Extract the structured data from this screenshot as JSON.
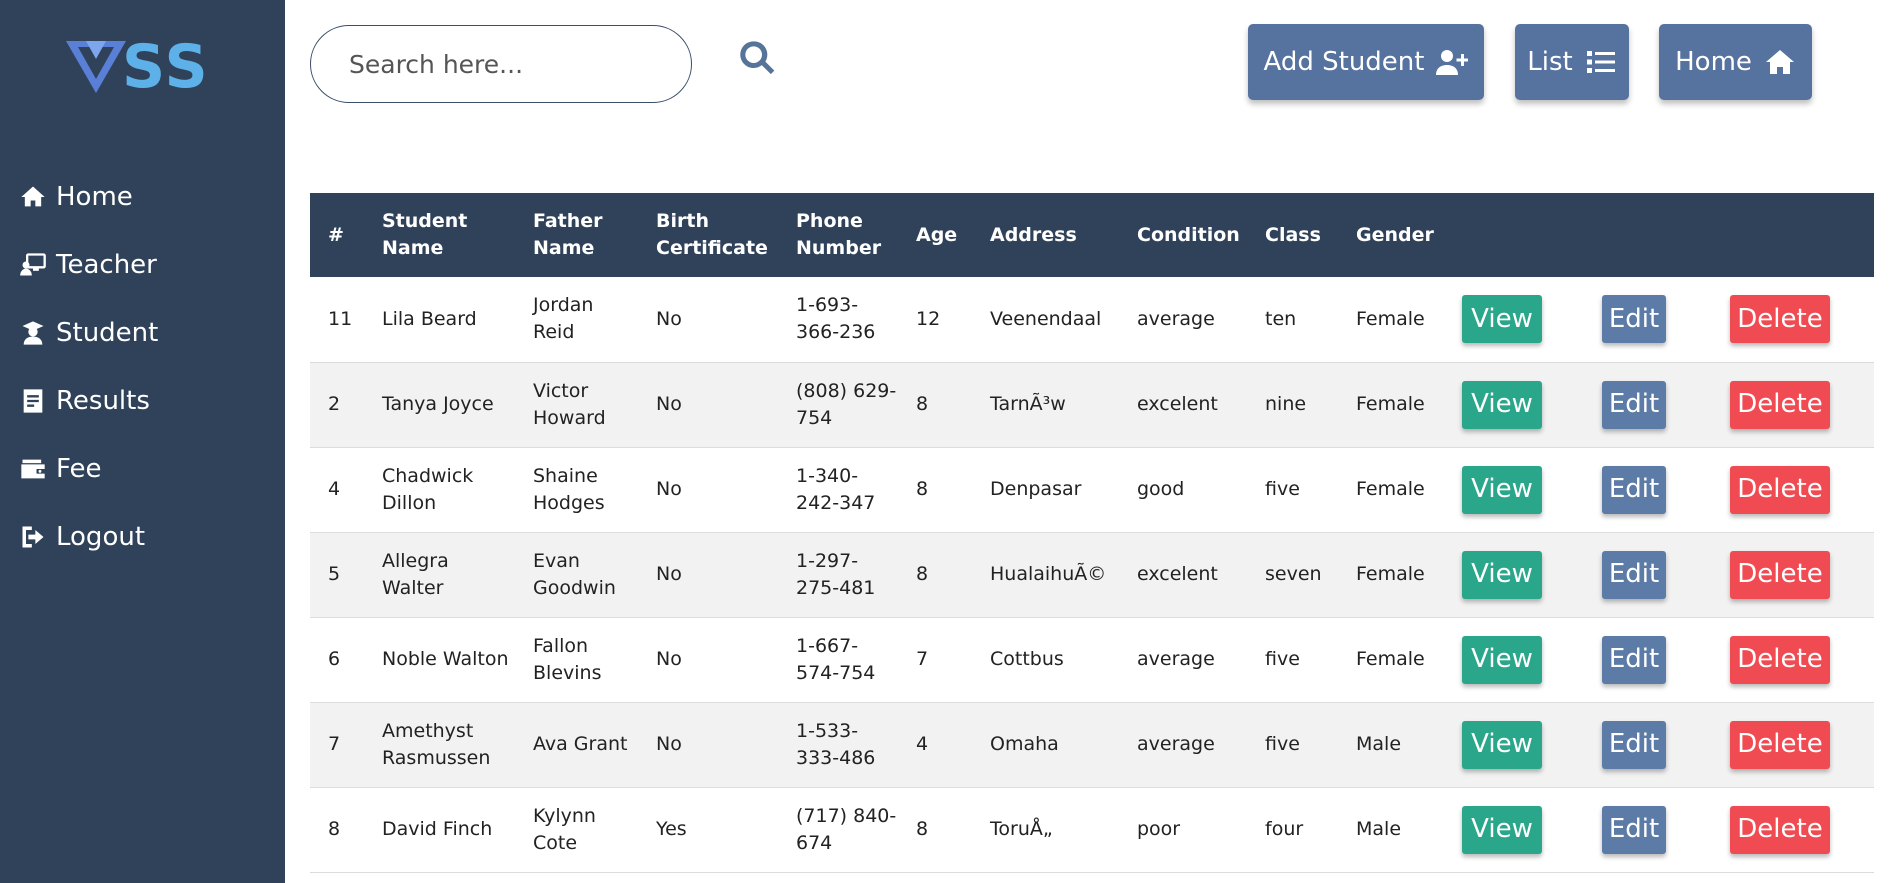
{
  "sidebar": {
    "logo_text": "SS",
    "logo_mark": "V",
    "items": [
      {
        "label": "Home",
        "icon": "home-icon"
      },
      {
        "label": "Teacher",
        "icon": "teacher-icon"
      },
      {
        "label": "Student",
        "icon": "student-icon"
      },
      {
        "label": "Results",
        "icon": "results-icon"
      },
      {
        "label": "Fee",
        "icon": "wallet-icon"
      },
      {
        "label": "Logout",
        "icon": "logout-icon"
      }
    ]
  },
  "search": {
    "placeholder": "Search here...",
    "value": ""
  },
  "toolbar": {
    "add_student": "Add Student",
    "list": "List",
    "home": "Home"
  },
  "table": {
    "headers": [
      "#",
      "Student Name",
      "Father Name",
      "Birth Certificate",
      "Phone Number",
      "Age",
      "Address",
      "Condition",
      "Class",
      "Gender"
    ],
    "rows": [
      {
        "id": "11",
        "student": "Lila Beard",
        "father": "Jordan Reid",
        "birth": "No",
        "phone": "1-693-366-236",
        "age": "12",
        "address": "Veenendaal",
        "condition": "average",
        "class": "ten",
        "gender": "Female"
      },
      {
        "id": "2",
        "student": "Tanya Joyce",
        "father": "Victor Howard",
        "birth": "No",
        "phone": "(808) 629-754",
        "age": "8",
        "address": "TarnÃ³w",
        "condition": "excelent",
        "class": "nine",
        "gender": "Female"
      },
      {
        "id": "4",
        "student": "Chadwick Dillon",
        "father": "Shaine Hodges",
        "birth": "No",
        "phone": "1-340-242-347",
        "age": "8",
        "address": "Denpasar",
        "condition": "good",
        "class": "five",
        "gender": "Female"
      },
      {
        "id": "5",
        "student": "Allegra Walter",
        "father": "Evan Goodwin",
        "birth": "No",
        "phone": "1-297-275-481",
        "age": "8",
        "address": "HualaihuÃ©",
        "condition": "excelent",
        "class": "seven",
        "gender": "Female"
      },
      {
        "id": "6",
        "student": "Noble Walton",
        "father": "Fallon Blevins",
        "birth": "No",
        "phone": "1-667-574-754",
        "age": "7",
        "address": "Cottbus",
        "condition": "average",
        "class": "five",
        "gender": "Female"
      },
      {
        "id": "7",
        "student": "Amethyst Rasmussen",
        "father": "Ava Grant",
        "birth": "No",
        "phone": "1-533-333-486",
        "age": "4",
        "address": "Omaha",
        "condition": "average",
        "class": "five",
        "gender": "Male"
      },
      {
        "id": "8",
        "student": "David Finch",
        "father": "Kylynn Cote",
        "birth": "Yes",
        "phone": "(717) 840-674",
        "age": "8",
        "address": "ToruÅ„",
        "condition": "poor",
        "class": "four",
        "gender": "Male"
      }
    ],
    "actions": {
      "view": "View",
      "edit": "Edit",
      "delete": "Delete"
    }
  },
  "colors": {
    "sidebar_bg": "#2f4259",
    "primary_button": "#56729f",
    "view_button": "#2aa68a",
    "edit_button": "#5c7ba6",
    "delete_button": "#f04b52",
    "logo": "#5eb1e8"
  }
}
